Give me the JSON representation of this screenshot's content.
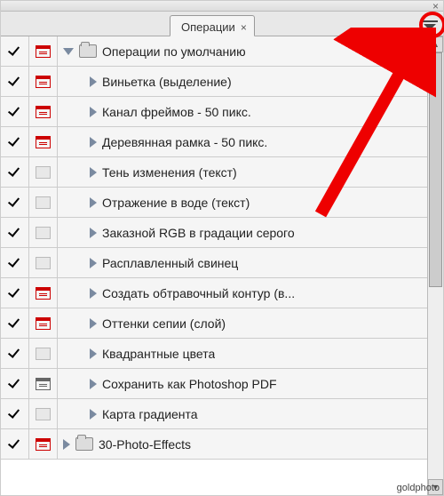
{
  "window": {
    "tab_label": "Операции",
    "close_glyph": "×"
  },
  "actions_panel": {
    "sets": [
      {
        "type": "set",
        "checked": true,
        "dialog": "red",
        "expanded": true,
        "label": "Операции по умолчанию",
        "items": [
          {
            "checked": true,
            "dialog": "red",
            "label": "Виньетка (выделение)"
          },
          {
            "checked": true,
            "dialog": "red",
            "label": "Канал фреймов - 50 пикс."
          },
          {
            "checked": true,
            "dialog": "red",
            "label": "Деревянная рамка - 50 пикс."
          },
          {
            "checked": true,
            "dialog": "none",
            "label": "Тень изменения (текст)"
          },
          {
            "checked": true,
            "dialog": "none",
            "label": "Отражение в воде (текст)"
          },
          {
            "checked": true,
            "dialog": "none",
            "label": "Заказной RGB в градации серого"
          },
          {
            "checked": true,
            "dialog": "none",
            "label": "Расплавленный свинец"
          },
          {
            "checked": true,
            "dialog": "red",
            "label": "Создать обтравочный контур (в..."
          },
          {
            "checked": true,
            "dialog": "red",
            "label": "Оттенки сепии (слой)"
          },
          {
            "checked": true,
            "dialog": "none",
            "label": "Квадрантные цвета"
          },
          {
            "checked": true,
            "dialog": "gray",
            "label": "Сохранить как Photoshop PDF"
          },
          {
            "checked": true,
            "dialog": "none",
            "label": "Карта градиента"
          }
        ]
      },
      {
        "type": "set",
        "checked": true,
        "dialog": "red",
        "expanded": false,
        "label": "30-Photo-Effects"
      }
    ]
  },
  "watermark": "goldphoto"
}
